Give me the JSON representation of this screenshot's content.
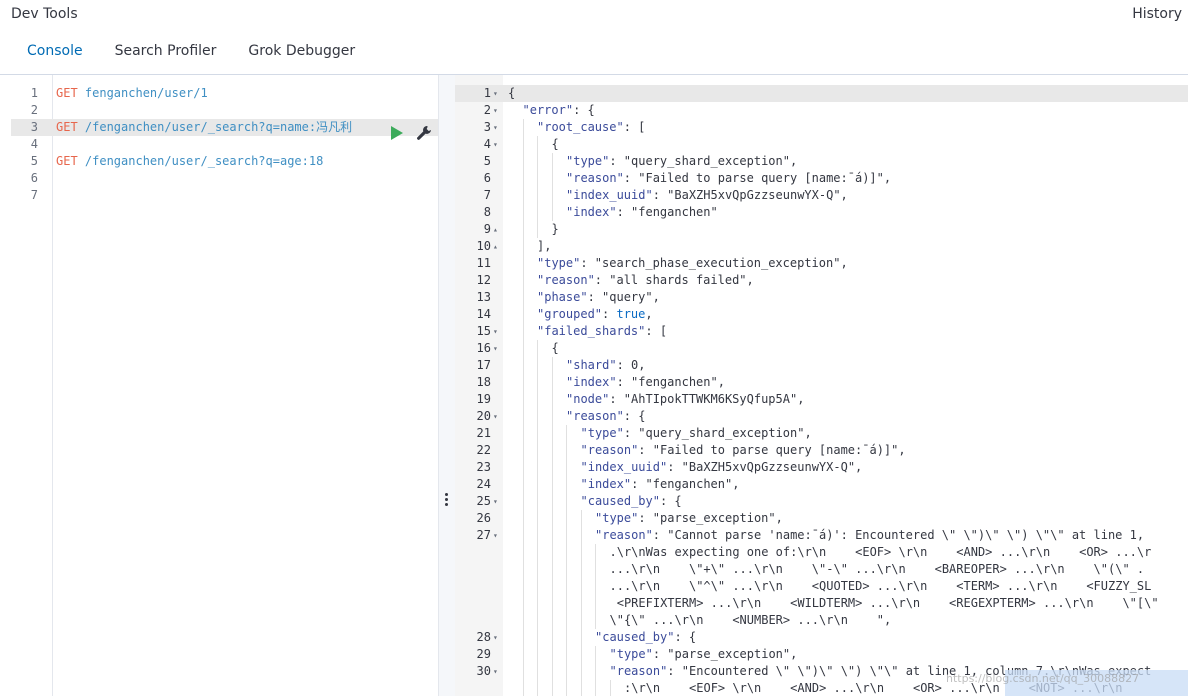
{
  "header": {
    "title": "Dev Tools",
    "history_label": "History",
    "tabs": [
      {
        "label": "Console",
        "active": true
      },
      {
        "label": "Search Profiler",
        "active": false
      },
      {
        "label": "Grok Debugger",
        "active": false
      }
    ]
  },
  "request_editor": {
    "lines": [
      {
        "num": "1",
        "method": "GET",
        "path": " fenganchen/user/1"
      },
      {
        "num": "2",
        "method": "",
        "path": ""
      },
      {
        "num": "3",
        "method": "GET",
        "path": " /fenganchen/user/_search?q=name:冯凡利"
      },
      {
        "num": "4",
        "method": "",
        "path": ""
      },
      {
        "num": "5",
        "method": "GET",
        "path": " /fenganchen/user/_search?q=age:18"
      },
      {
        "num": "6",
        "method": "",
        "path": ""
      },
      {
        "num": "7",
        "method": "",
        "path": ""
      }
    ],
    "highlight_line": 3,
    "actions": {
      "play_icon": "play-icon",
      "wrench_icon": "wrench-icon"
    }
  },
  "response": {
    "lines": [
      {
        "num": "1",
        "fold": "▾",
        "indent": 0,
        "text": "{"
      },
      {
        "num": "2",
        "fold": "▾",
        "indent": 1,
        "key": "\"error\"",
        "rest": ": {"
      },
      {
        "num": "3",
        "fold": "▾",
        "indent": 2,
        "key": "\"root_cause\"",
        "rest": ": ["
      },
      {
        "num": "4",
        "fold": "▾",
        "indent": 3,
        "text": "{"
      },
      {
        "num": "5",
        "fold": "",
        "indent": 4,
        "key": "\"type\"",
        "rest": ": \"query_shard_exception\","
      },
      {
        "num": "6",
        "fold": "",
        "indent": 4,
        "key": "\"reason\"",
        "rest": ": \"Failed to parse query [name:¯á)]\","
      },
      {
        "num": "7",
        "fold": "",
        "indent": 4,
        "key": "\"index_uuid\"",
        "rest": ": \"BaXZH5xvQpGzzseunwYX-Q\","
      },
      {
        "num": "8",
        "fold": "",
        "indent": 4,
        "key": "\"index\"",
        "rest": ": \"fenganchen\""
      },
      {
        "num": "9",
        "fold": "▴",
        "indent": 3,
        "text": "}"
      },
      {
        "num": "10",
        "fold": "▴",
        "indent": 2,
        "text": "],"
      },
      {
        "num": "11",
        "fold": "",
        "indent": 2,
        "key": "\"type\"",
        "rest": ": \"search_phase_execution_exception\","
      },
      {
        "num": "12",
        "fold": "",
        "indent": 2,
        "key": "\"reason\"",
        "rest": ": \"all shards failed\","
      },
      {
        "num": "13",
        "fold": "",
        "indent": 2,
        "key": "\"phase\"",
        "rest": ": \"query\","
      },
      {
        "num": "14",
        "fold": "",
        "indent": 2,
        "key": "\"grouped\"",
        "rest": ": ",
        "bool": "true",
        "tail": ","
      },
      {
        "num": "15",
        "fold": "▾",
        "indent": 2,
        "key": "\"failed_shards\"",
        "rest": ": ["
      },
      {
        "num": "16",
        "fold": "▾",
        "indent": 3,
        "text": "{"
      },
      {
        "num": "17",
        "fold": "",
        "indent": 4,
        "key": "\"shard\"",
        "rest": ": 0,"
      },
      {
        "num": "18",
        "fold": "",
        "indent": 4,
        "key": "\"index\"",
        "rest": ": \"fenganchen\","
      },
      {
        "num": "19",
        "fold": "",
        "indent": 4,
        "key": "\"node\"",
        "rest": ": \"AhTIpokTTWKM6KSyQfup5A\","
      },
      {
        "num": "20",
        "fold": "▾",
        "indent": 4,
        "key": "\"reason\"",
        "rest": ": {"
      },
      {
        "num": "21",
        "fold": "",
        "indent": 5,
        "key": "\"type\"",
        "rest": ": \"query_shard_exception\","
      },
      {
        "num": "22",
        "fold": "",
        "indent": 5,
        "key": "\"reason\"",
        "rest": ": \"Failed to parse query [name:¯á)]\","
      },
      {
        "num": "23",
        "fold": "",
        "indent": 5,
        "key": "\"index_uuid\"",
        "rest": ": \"BaXZH5xvQpGzzseunwYX-Q\","
      },
      {
        "num": "24",
        "fold": "",
        "indent": 5,
        "key": "\"index\"",
        "rest": ": \"fenganchen\","
      },
      {
        "num": "25",
        "fold": "▾",
        "indent": 5,
        "key": "\"caused_by\"",
        "rest": ": {"
      },
      {
        "num": "26",
        "fold": "",
        "indent": 6,
        "key": "\"type\"",
        "rest": ": \"parse_exception\","
      },
      {
        "num": "27",
        "fold": "▾",
        "indent": 6,
        "key": "\"reason\"",
        "rest": ": \"Cannot parse 'name:¯á)': Encountered \\\" \\\")\\\" \\\") \\\"\\\" at line 1,"
      },
      {
        "num": "",
        "fold": "",
        "indent": 7,
        "text": ".\\r\\nWas expecting one of:\\r\\n    <EOF> \\r\\n    <AND> ...\\r\\n    <OR> ...\\r"
      },
      {
        "num": "",
        "fold": "",
        "indent": 7,
        "text": "...\\r\\n    \\\"+\\\" ...\\r\\n    \\\"-\\\" ...\\r\\n    <BAREOPER> ...\\r\\n    \\\"(\\\" ."
      },
      {
        "num": "",
        "fold": "",
        "indent": 7,
        "text": "...\\r\\n    \\\"^\\\" ...\\r\\n    <QUOTED> ...\\r\\n    <TERM> ...\\r\\n    <FUZZY_SL"
      },
      {
        "num": "",
        "fold": "",
        "indent": 7,
        "text": " <PREFIXTERM> ...\\r\\n    <WILDTERM> ...\\r\\n    <REGEXPTERM> ...\\r\\n    \\\"[\\\""
      },
      {
        "num": "",
        "fold": "",
        "indent": 7,
        "text": "\\\"{\\\" ...\\r\\n    <NUMBER> ...\\r\\n    \","
      },
      {
        "num": "28",
        "fold": "▾",
        "indent": 6,
        "key": "\"caused_by\"",
        "rest": ": {"
      },
      {
        "num": "29",
        "fold": "",
        "indent": 7,
        "key": "\"type\"",
        "rest": ": \"parse_exception\","
      },
      {
        "num": "30",
        "fold": "▾",
        "indent": 7,
        "key": "\"reason\"",
        "rest": ": \"Encountered \\\" \\\")\\\" \\\") \\\"\\\" at line 1, column 7.\\r\\nWas expect"
      },
      {
        "num": "",
        "fold": "",
        "indent": 8,
        "text": ":\\r\\n    <EOF> \\r\\n    <AND> ...\\r\\n    <OR> ...\\r\\n    <NOT> ...\\r\\n"
      }
    ]
  },
  "watermark": "https://blog.csdn.net/qq_30088827"
}
